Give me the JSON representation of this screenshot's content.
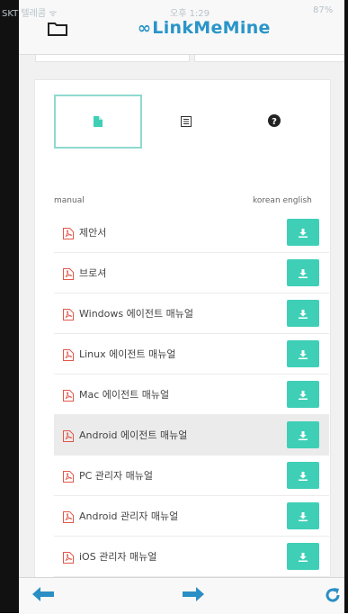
{
  "status": {
    "carrier": "SKT 텔레콤 ᯤ",
    "time": "오후 1:29",
    "battery": "87%"
  },
  "header": {
    "logo_mark": "∞",
    "logo_text": "LinkMeMine"
  },
  "tabs": [
    {
      "icon": "document-icon",
      "active": true
    },
    {
      "icon": "list-icon",
      "active": false
    },
    {
      "icon": "help-icon",
      "active": false
    }
  ],
  "table": {
    "col_manual": "manual",
    "col_lang": "korean english",
    "rows": [
      {
        "label": "제안서"
      },
      {
        "label": "브로셔"
      },
      {
        "label": "Windows 에이전트 매뉴얼"
      },
      {
        "label": "Linux 에이전트 매뉴얼"
      },
      {
        "label": "Mac 에이전트 매뉴얼"
      },
      {
        "label": "Android 에이전트 매뉴얼",
        "highlighted": true
      },
      {
        "label": "PC 관리자 매뉴얼"
      },
      {
        "label": "Android 관리자 매뉴얼"
      },
      {
        "label": "iOS 관리자 매뉴얼"
      }
    ]
  },
  "colors": {
    "accent": "#3fcfb7",
    "brand": "#2a95c9",
    "pdf": "#e0584a",
    "nav": "#2a8fc4"
  }
}
